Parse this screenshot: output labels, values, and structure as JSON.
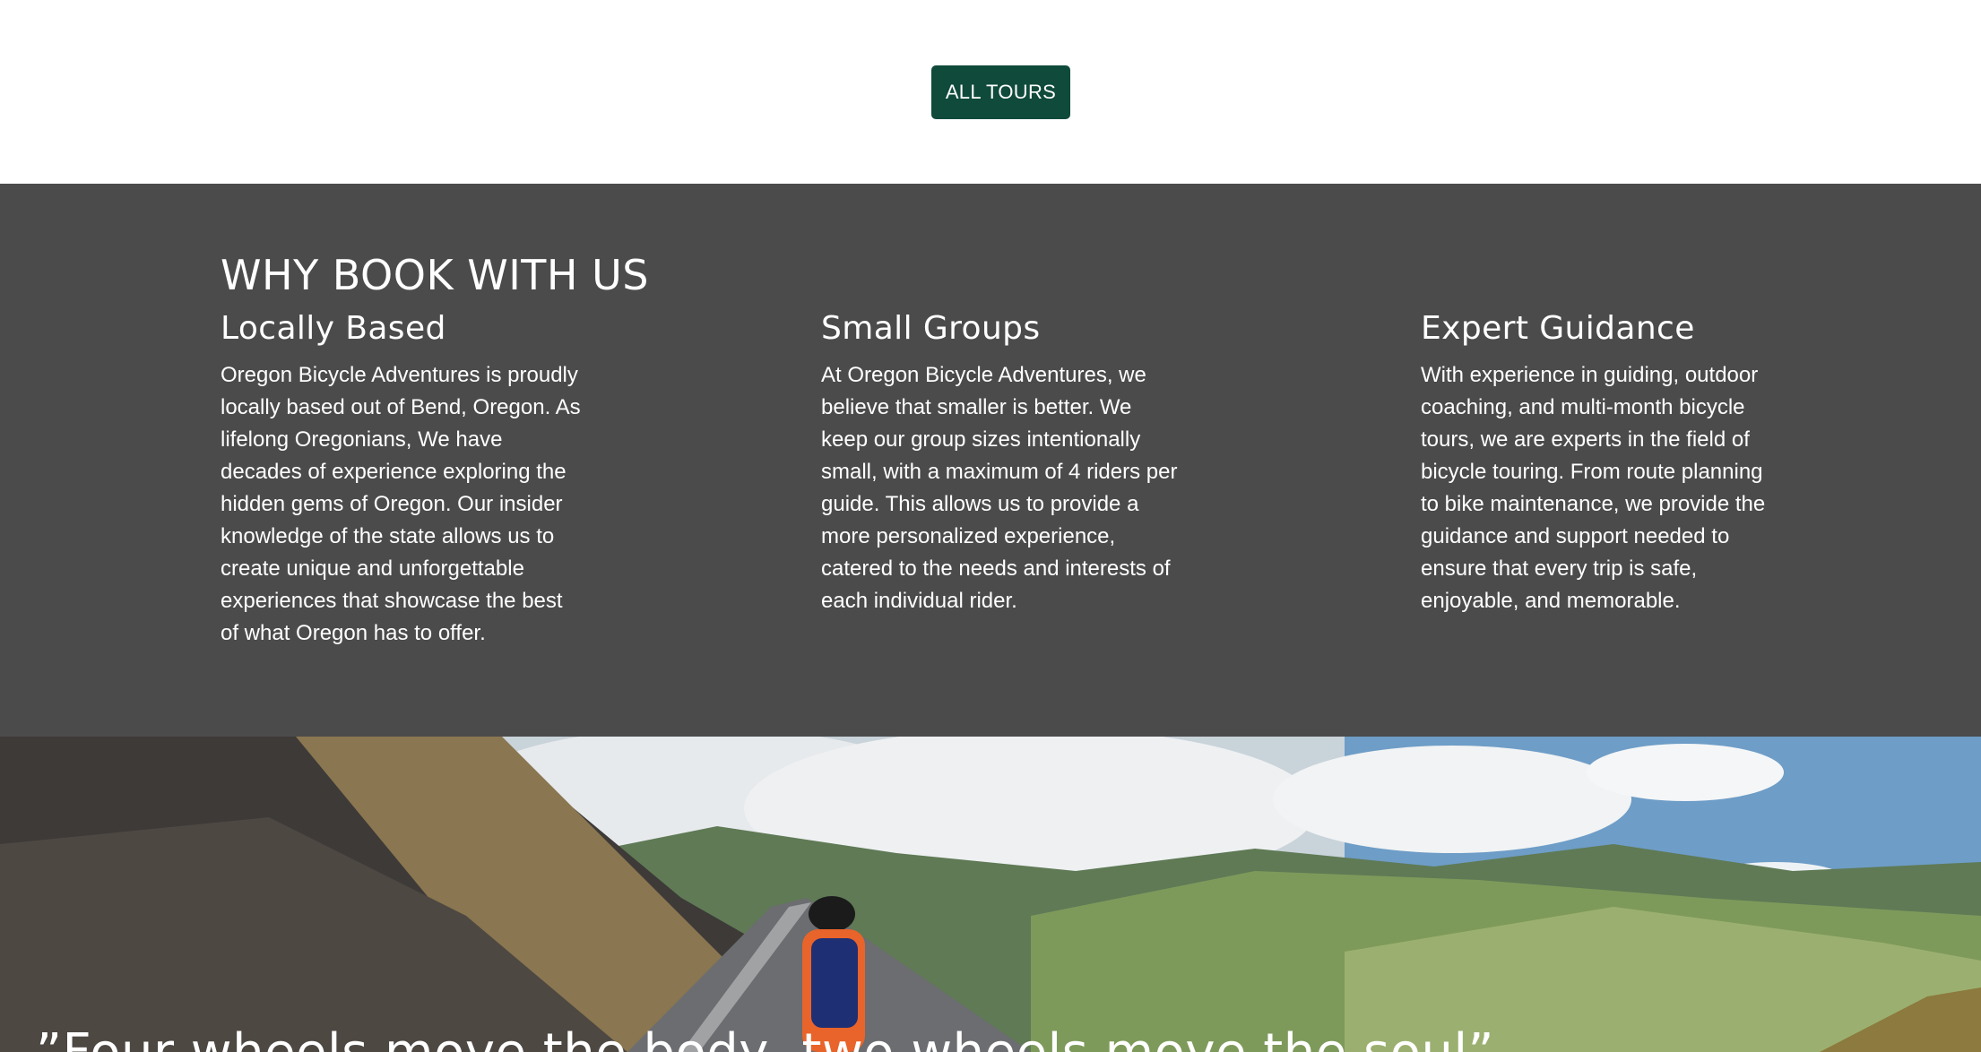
{
  "top": {
    "all_tours_label": "ALL TOURS"
  },
  "why": {
    "title": "WHY BOOK WITH US",
    "features": [
      {
        "title": "Locally Based",
        "text": "Oregon Bicycle Adventures is proudly locally based out of Bend, Oregon. As lifelong Oregonians, We have decades of experience exploring the hidden gems of Oregon. Our insider knowledge of the state allows us to create unique and unforgettable experiences that showcase the best of what Oregon has to offer."
      },
      {
        "title": "Small Groups",
        "text": "At Oregon Bicycle Adventures, we believe that smaller is better. We keep our group sizes intentionally small, with a maximum of 4 riders per guide. This allows us to provide a more personalized experience, catered to the needs and interests of each individual rider."
      },
      {
        "title": "Expert Guidance",
        "text": "With experience in guiding, outdoor coaching, and multi-month bicycle tours, we are experts in the field of bicycle touring. From route planning to bike maintenance, we provide the guidance and support needed to ensure that every trip is safe, enjoyable, and memorable."
      }
    ]
  },
  "hero": {
    "quote": "”Four wheels move the body, two wheels move the soul”"
  },
  "colors": {
    "button_bg": "#0f4a3a",
    "section_bg": "#4b4b4b"
  }
}
